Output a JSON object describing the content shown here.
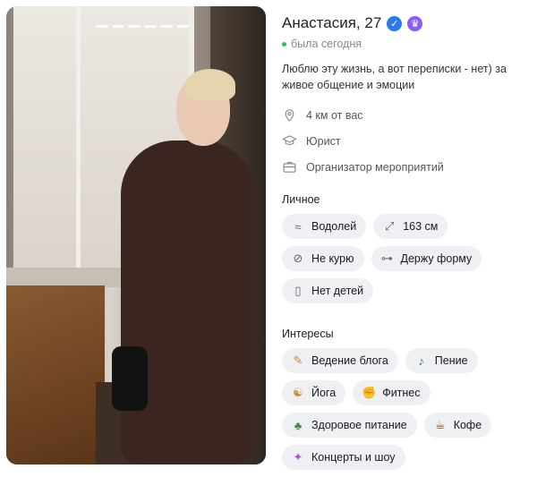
{
  "profile": {
    "name_age": "Анастасия, 27",
    "status": "была сегодня",
    "bio": "Люблю эту жизнь, а вот переписки - нет) за живое общение и эмоции",
    "distance": "4 км от вас",
    "job": "Юрист",
    "occupation": "Организатор мероприятий",
    "photo_count": 6,
    "badges": {
      "verified_color": "#2b7be8",
      "premium_color": "#8b5cf6"
    }
  },
  "personal": {
    "label": "Личное",
    "tags": [
      {
        "icon": "aquarius-icon",
        "glyph": "≈",
        "label": "Водолей"
      },
      {
        "icon": "height-icon",
        "glyph": "⤢",
        "label": "163 см"
      },
      {
        "icon": "no-smoking-icon",
        "glyph": "⊘",
        "label": "Не курю"
      },
      {
        "icon": "dumbbell-icon",
        "glyph": "⊶",
        "label": "Держу форму"
      },
      {
        "icon": "baby-bottle-icon",
        "glyph": "▯",
        "label": "Нет детей"
      }
    ]
  },
  "interests": {
    "label": "Интересы",
    "tags": [
      {
        "icon": "pen-icon",
        "glyph": "✎",
        "label": "Ведение блога"
      },
      {
        "icon": "singing-icon",
        "glyph": "♪",
        "label": "Пение"
      },
      {
        "icon": "yoga-icon",
        "glyph": "☯",
        "label": "Йога"
      },
      {
        "icon": "flexed-arm-icon",
        "glyph": "✊",
        "label": "Фитнес"
      },
      {
        "icon": "broccoli-icon",
        "glyph": "♣",
        "label": "Здоровое питание"
      },
      {
        "icon": "coffee-icon",
        "glyph": "☕",
        "label": "Кофе"
      },
      {
        "icon": "sparkle-icon",
        "glyph": "✦",
        "label": "Концерты и шоу"
      }
    ]
  }
}
